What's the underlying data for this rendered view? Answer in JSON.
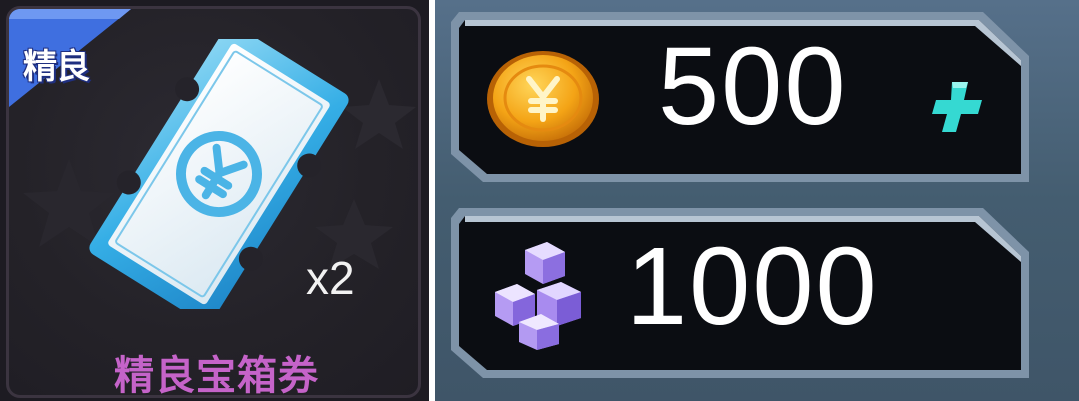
{
  "item": {
    "rarity": "精良",
    "quantity": "x2",
    "name": "精良宝箱券",
    "icon": "ticket-icon",
    "colors": {
      "rarity_badge": "#3f6fe0",
      "name": "#c563c9",
      "ticket": "#3cb3e6"
    }
  },
  "currencies": {
    "gold": {
      "icon": "gold-coin-icon",
      "amount": "500",
      "action_icon": "plus-icon",
      "action_color": "#35d9d2"
    },
    "gems": {
      "icon": "purple-crystal-icon",
      "amount": "1000"
    }
  }
}
